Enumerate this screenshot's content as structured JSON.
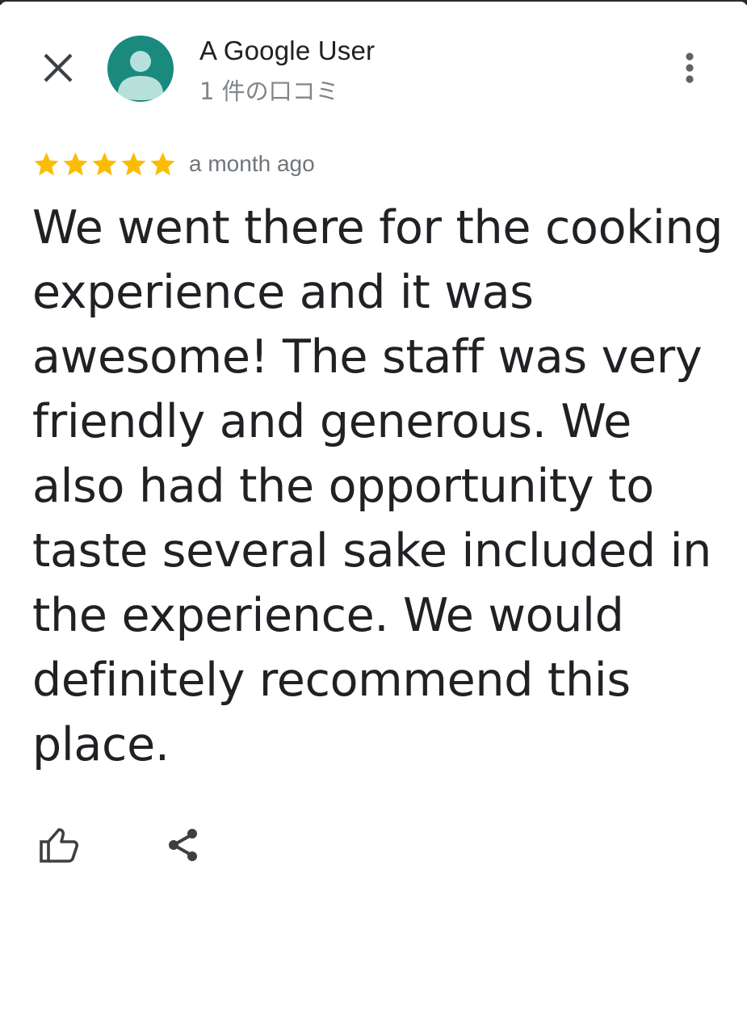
{
  "reviewer": {
    "name": "A Google User",
    "review_count": "1 件の口コミ",
    "avatar_color": "#1a8a7f"
  },
  "review": {
    "rating": 5,
    "max_rating": 5,
    "star_color": "#fbbc04",
    "time_ago": "a month ago",
    "text": "We went there for the cooking experience and it was awesome! The staff was very friendly and generous. We also had the opportunity to taste several sake included in the experience. We would definitely recommend this place."
  },
  "icons": {
    "close": "close-icon",
    "more": "more-vert-icon",
    "like": "thumbs-up-icon",
    "share": "share-icon",
    "star": "star-icon",
    "avatar": "person-icon"
  }
}
